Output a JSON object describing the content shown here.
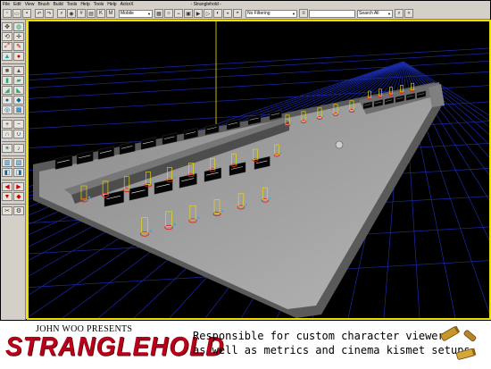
{
  "menubar": {
    "items": [
      "File",
      "Edit",
      "View",
      "Brush",
      "Build",
      "Tools",
      "Help",
      "Tools",
      "Help",
      "ActorX"
    ],
    "title": "- Stranglehold -"
  },
  "toolbar": {
    "camera_select": "Mobile",
    "filter_select": "No Filtering",
    "search_placeholder": "",
    "actor_select": "Search All"
  },
  "banner": {
    "presents": "JOHN WOO PRESENTS",
    "game_title": "STRANGLEHOLD",
    "caption_line_1": "Responsible for custom character viewer",
    "caption_line_2": "as well as metrics and cinema kismet setups"
  },
  "colors": {
    "title_red": "#b8001a",
    "viewport_frame": "#f0e000",
    "grid_blue": "#1a2aa8",
    "level_floor": "#9a9a9a"
  },
  "icons": [
    "camera-icon",
    "rotate-icon",
    "scale-icon",
    "brush-icon",
    "cube-icon",
    "sphere-icon",
    "terrain-icon",
    "volume-icon",
    "light-icon",
    "sound-icon",
    "bullet-shells-icon"
  ]
}
